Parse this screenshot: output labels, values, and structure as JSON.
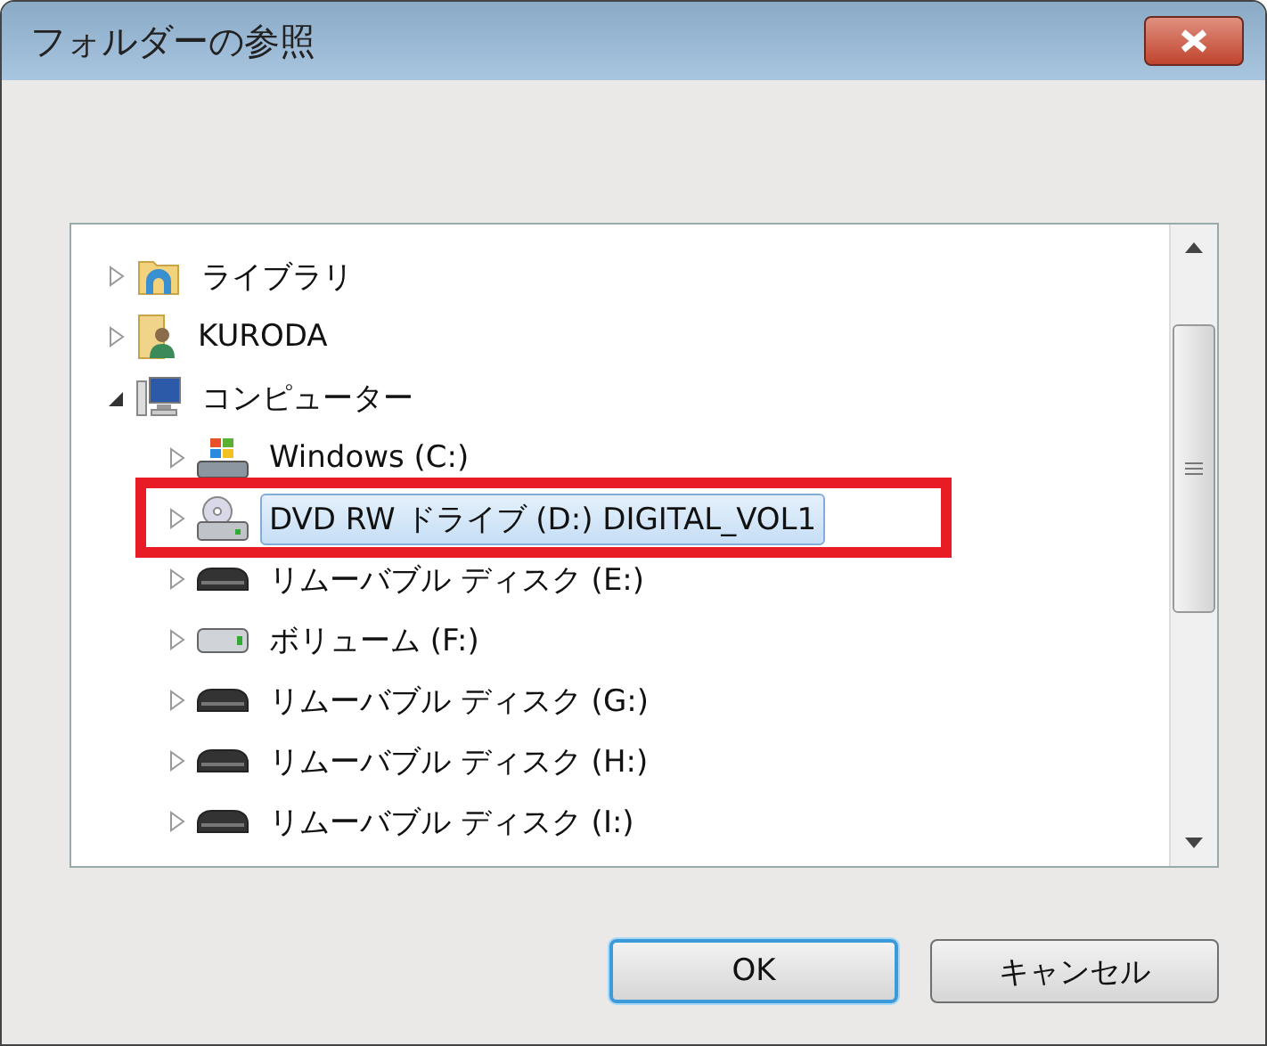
{
  "window": {
    "title": "フォルダーの参照"
  },
  "tree": [
    {
      "label": "ライブラリ",
      "kind": "library",
      "expanded": false,
      "selected": false,
      "highlighted": false
    },
    {
      "label": "KURODA",
      "kind": "user",
      "expanded": false,
      "selected": false,
      "highlighted": false
    },
    {
      "label": "コンピューター",
      "kind": "computer",
      "expanded": true,
      "selected": false,
      "highlighted": false,
      "children": [
        {
          "label": "Windows (C:)",
          "kind": "system-drive",
          "expanded": false,
          "selected": false,
          "highlighted": false
        },
        {
          "label": "DVD RW ドライブ (D:) DIGITAL_VOL1",
          "kind": "dvd",
          "expanded": false,
          "selected": true,
          "highlighted": true
        },
        {
          "label": "リムーバブル ディスク (E:)",
          "kind": "removable",
          "expanded": false,
          "selected": false,
          "highlighted": false
        },
        {
          "label": "ボリューム (F:)",
          "kind": "volume",
          "expanded": false,
          "selected": false,
          "highlighted": false
        },
        {
          "label": "リムーバブル ディスク (G:)",
          "kind": "removable",
          "expanded": false,
          "selected": false,
          "highlighted": false
        },
        {
          "label": "リムーバブル ディスク (H:)",
          "kind": "removable",
          "expanded": false,
          "selected": false,
          "highlighted": false
        },
        {
          "label": "リムーバブル ディスク (I:)",
          "kind": "removable",
          "expanded": false,
          "selected": false,
          "highlighted": false
        }
      ]
    }
  ],
  "buttons": [
    {
      "label": "OK",
      "default": true
    },
    {
      "label": "キャンセル",
      "default": false
    }
  ]
}
